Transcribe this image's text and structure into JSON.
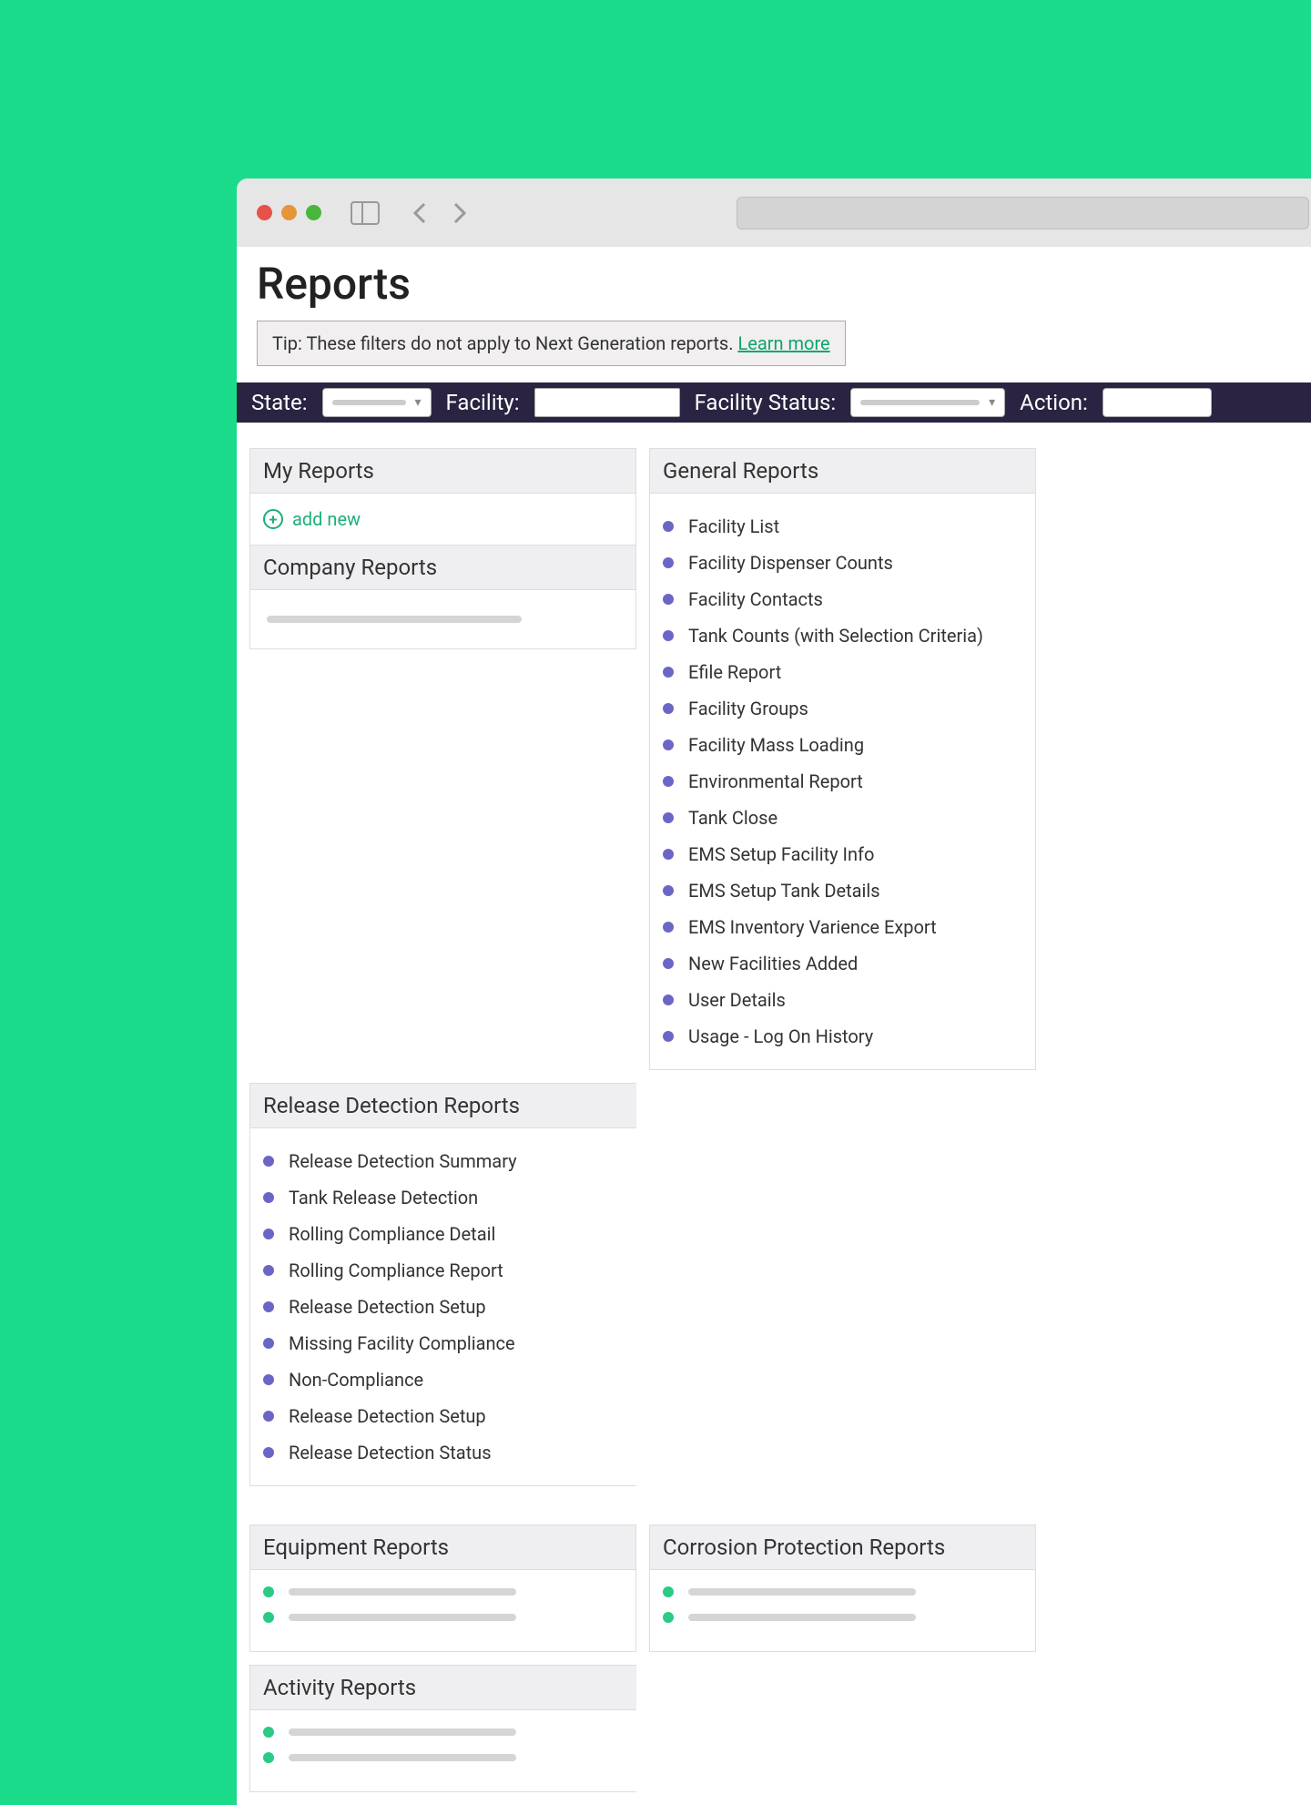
{
  "page": {
    "title": "Reports"
  },
  "tip": {
    "text": "Tip: These filters do not apply to Next Generation reports. ",
    "link_text": "Learn more"
  },
  "filters": {
    "state_label": "State:",
    "facility_label": "Facility:",
    "facility_status_label": "Facility Status:",
    "action_label": "Action:"
  },
  "panels": {
    "my_reports": {
      "title": "My Reports",
      "add_new_label": "add new"
    },
    "company_reports": {
      "title": "Company Reports"
    },
    "general_reports": {
      "title": "General Reports",
      "items": [
        "Facility List",
        "Facility Dispenser Counts",
        "Facility Contacts",
        "Tank Counts (with Selection Criteria)",
        "Efile Report",
        "Facility Groups",
        "Facility Mass Loading",
        "Environmental Report",
        "Tank Close",
        "EMS Setup Facility Info",
        "EMS Setup Tank Details",
        "EMS Inventory Varience Export",
        "New Facilities Added",
        "User Details",
        "Usage - Log On History"
      ]
    },
    "release_detection": {
      "title": "Release Detection Reports",
      "items": [
        "Release Detection Summary",
        "Tank Release Detection",
        "Rolling Compliance Detail",
        "Rolling Compliance Report",
        "Release Detection Setup",
        "Missing Facility Compliance",
        "Non-Compliance",
        "Release Detection Setup",
        "Release Detection Status"
      ]
    },
    "equipment_reports": {
      "title": "Equipment Reports"
    },
    "corrosion_reports": {
      "title": "Corrosion Protection Reports"
    },
    "activity_reports": {
      "title": "Activity Reports"
    }
  }
}
